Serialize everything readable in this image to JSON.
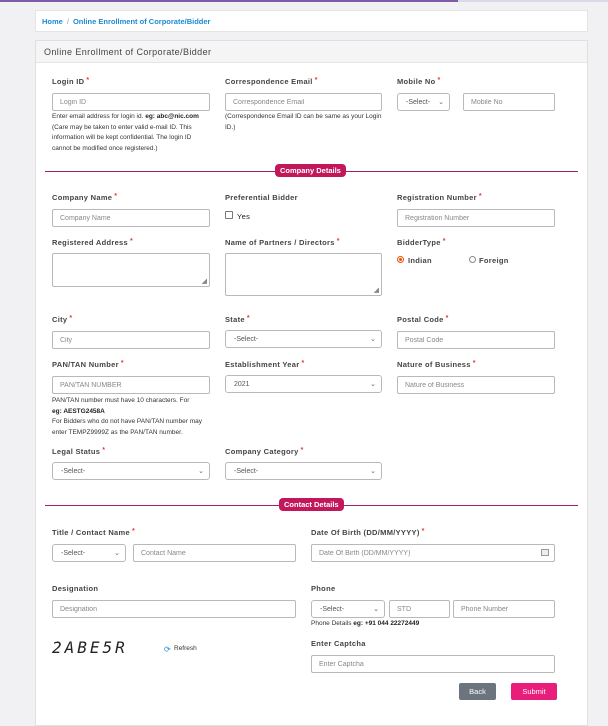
{
  "breadcrumb": {
    "home": "Home",
    "sep": "/",
    "current": "Online Enrollment of Corporate/Bidder"
  },
  "panel": {
    "title": "Online Enrollment of Corporate/Bidder"
  },
  "required_mark": "*",
  "login": {
    "login_id_label": "Login ID",
    "login_id_placeholder": "Login ID",
    "login_help_1": "Enter email address for login id. ",
    "login_help_eg": "eg: abc@nic.com",
    "login_help_2": "(Care may be taken to enter valid e-mail ID. This information will be kept confidential. The login ID cannot be modified once registered.)",
    "email_label": "Correspondence Email",
    "email_placeholder": "Correspondence Email",
    "email_help": "(Correspondence Email ID can be same as your Login ID.)",
    "mobile_label": "Mobile No",
    "mobile_code": "-Select-",
    "mobile_placeholder": "Mobile No"
  },
  "company": {
    "section_title": "Company Details",
    "name_label": "Company Name",
    "name_placeholder": "Company Name",
    "pref_label": "Preferential Bidder",
    "pref_yes": "Yes",
    "reg_label": "Registration Number",
    "reg_placeholder": "Registration Number",
    "address_label": "Registered Address",
    "partners_label": "Name of Partners / Directors",
    "bidder_type_label": "BidderType",
    "bidder_indian": "Indian",
    "bidder_foreign": "Foreign",
    "city_label": "City",
    "city_placeholder": "City",
    "state_label": "State",
    "state_value": "-Select-",
    "postal_label": "Postal Code",
    "postal_placeholder": "Postal Code",
    "pan_label": "PAN/TAN Number",
    "pan_placeholder": "PAN/TAN NUMBER",
    "pan_help_1": "PAN/TAN number must have 10 characters. For",
    "pan_help_eg": "eg: AESTG2458A",
    "pan_help_2": "For Bidders who do not have PAN/TAN number may enter TEMPZ9999Z as the PAN/TAN number.",
    "estab_label": "Establishment Year",
    "estab_value": "2021",
    "nature_label": "Nature of Business",
    "nature_placeholder": "Nature of Business",
    "legal_label": "Legal Status",
    "legal_value": "-Select-",
    "category_label": "Company Category",
    "category_value": "-Select-"
  },
  "contact": {
    "section_title": "Contact Details",
    "title_label": "Title / Contact Name",
    "title_value": "-Select-",
    "name_placeholder": "Contact Name",
    "dob_label": "Date Of Birth (DD/MM/YYYY)",
    "dob_placeholder": "Date Of Birth (DD/MM/YYYY)",
    "designation_label": "Designation",
    "designation_placeholder": "Designation",
    "phone_label": "Phone",
    "phone_code": "-Select-",
    "std_placeholder": "STD",
    "phone_placeholder": "Phone Number",
    "phone_help": "Phone Details ",
    "phone_help_eg": "eg: +91 044 22272449",
    "captcha_text": "2ABE5R",
    "refresh_label": "Refresh",
    "captcha_label": "Enter Captcha",
    "captcha_placeholder": "Enter Captcha"
  },
  "actions": {
    "back": "Back",
    "submit": "Submit"
  },
  "colors": {
    "accent": "#c2185b",
    "link": "#1b8bd1",
    "back_btn": "#6c757d"
  }
}
